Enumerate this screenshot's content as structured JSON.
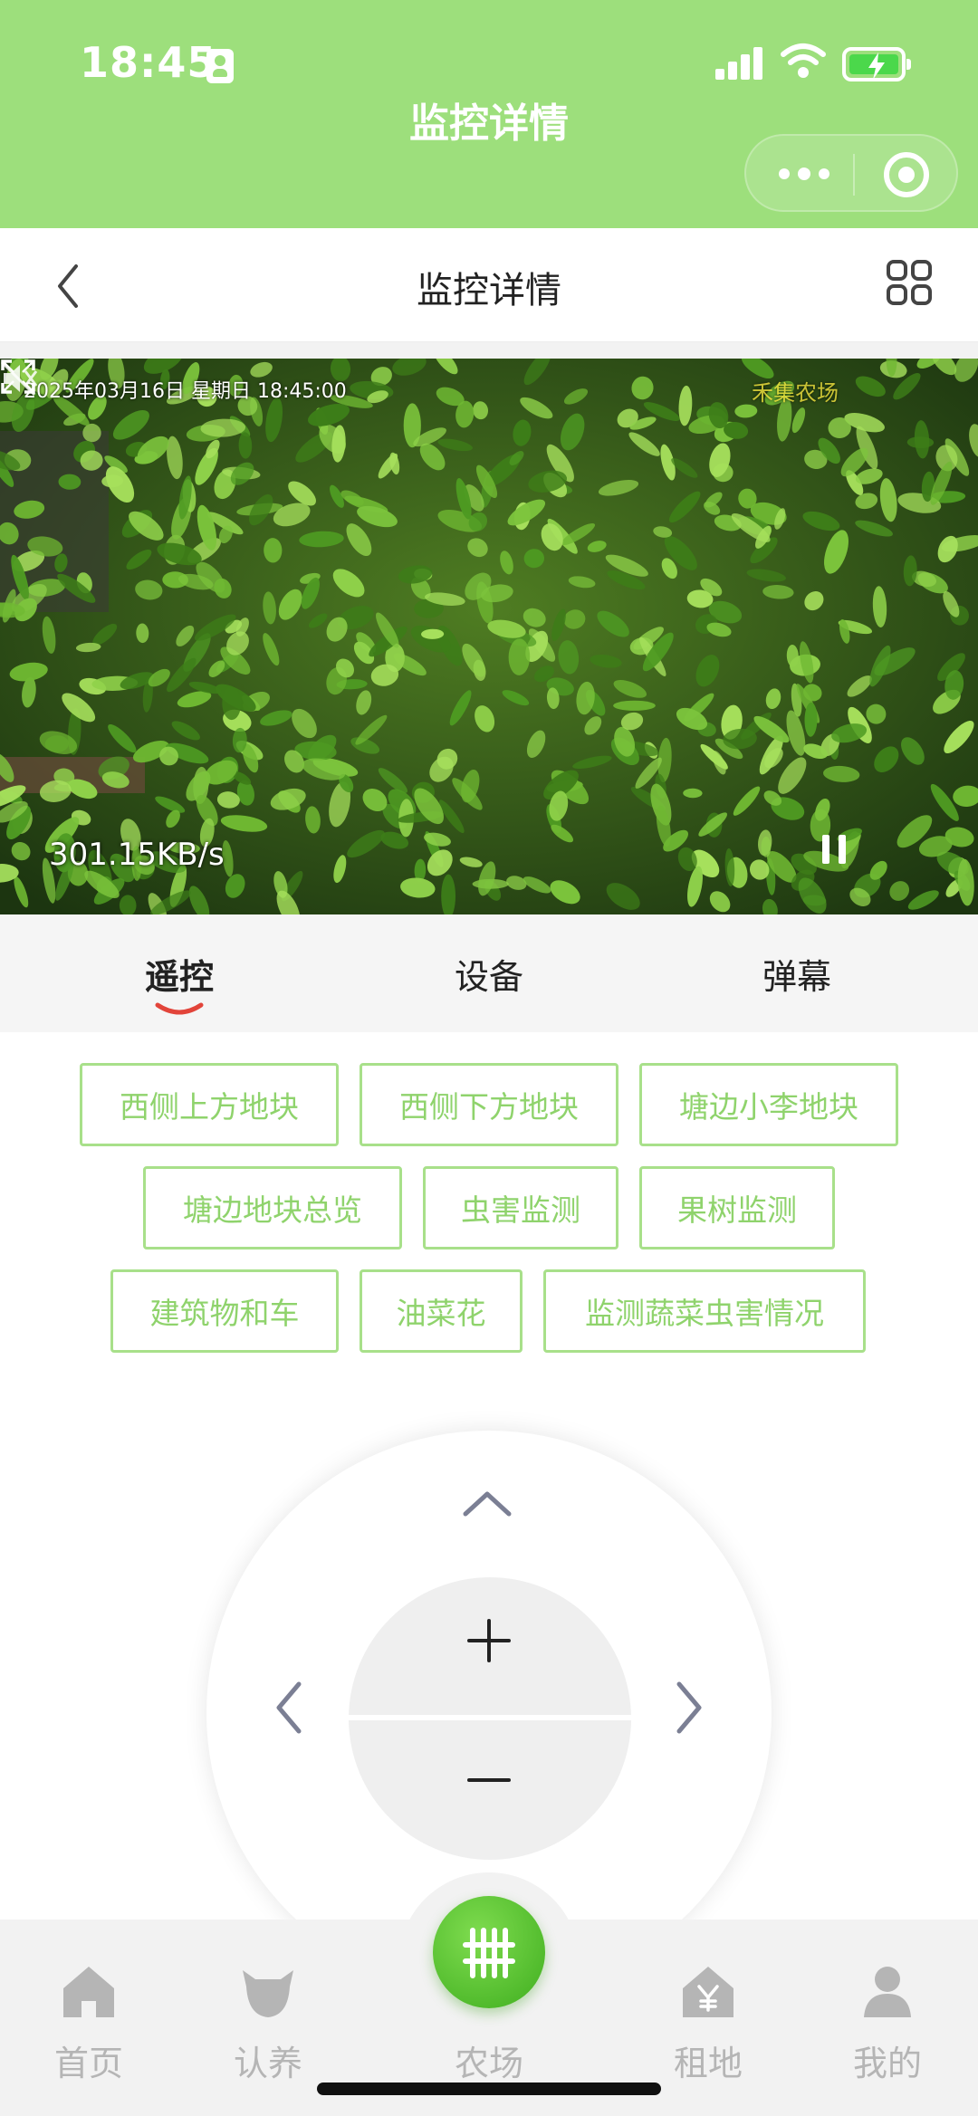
{
  "status_bar": {
    "time": "18:45"
  },
  "mini_program": {
    "title": "监控详情"
  },
  "nav": {
    "title": "监控详情"
  },
  "video": {
    "osd_datetime": "2025年03月16日  星期日  18:45:00",
    "osd_channel": "禾集农场",
    "speed": "301.15KB/s"
  },
  "tabs": [
    {
      "label": "遥控",
      "active": true
    },
    {
      "label": "设备",
      "active": false
    },
    {
      "label": "弹幕",
      "active": false
    }
  ],
  "presets": [
    "西侧上方地块",
    "西侧下方地块",
    "塘边小李地块",
    "塘边地块总览",
    "虫害监测",
    "果树监测",
    "建筑物和车",
    "油菜花",
    "监测蔬菜虫害情况"
  ],
  "controller": {
    "up_icon": "chevron-up-icon",
    "left_icon": "chevron-left-icon",
    "right_icon": "chevron-right-icon",
    "zoom_in_icon": "plus-icon",
    "zoom_out_icon": "minus-icon"
  },
  "tabbar": [
    {
      "label": "首页",
      "icon": "home-icon"
    },
    {
      "label": "认养",
      "icon": "cow-icon"
    },
    {
      "label": "农场",
      "icon": "fence-icon"
    },
    {
      "label": "租地",
      "icon": "yuan-house-icon"
    },
    {
      "label": "我的",
      "icon": "user-icon"
    }
  ],
  "colors": {
    "brand_green": "#9ddf7c",
    "preset_border": "#a8e08a",
    "preset_text": "#8fd36c",
    "tab_underline": "#e2443a",
    "farm_button": "#4cbb28"
  }
}
